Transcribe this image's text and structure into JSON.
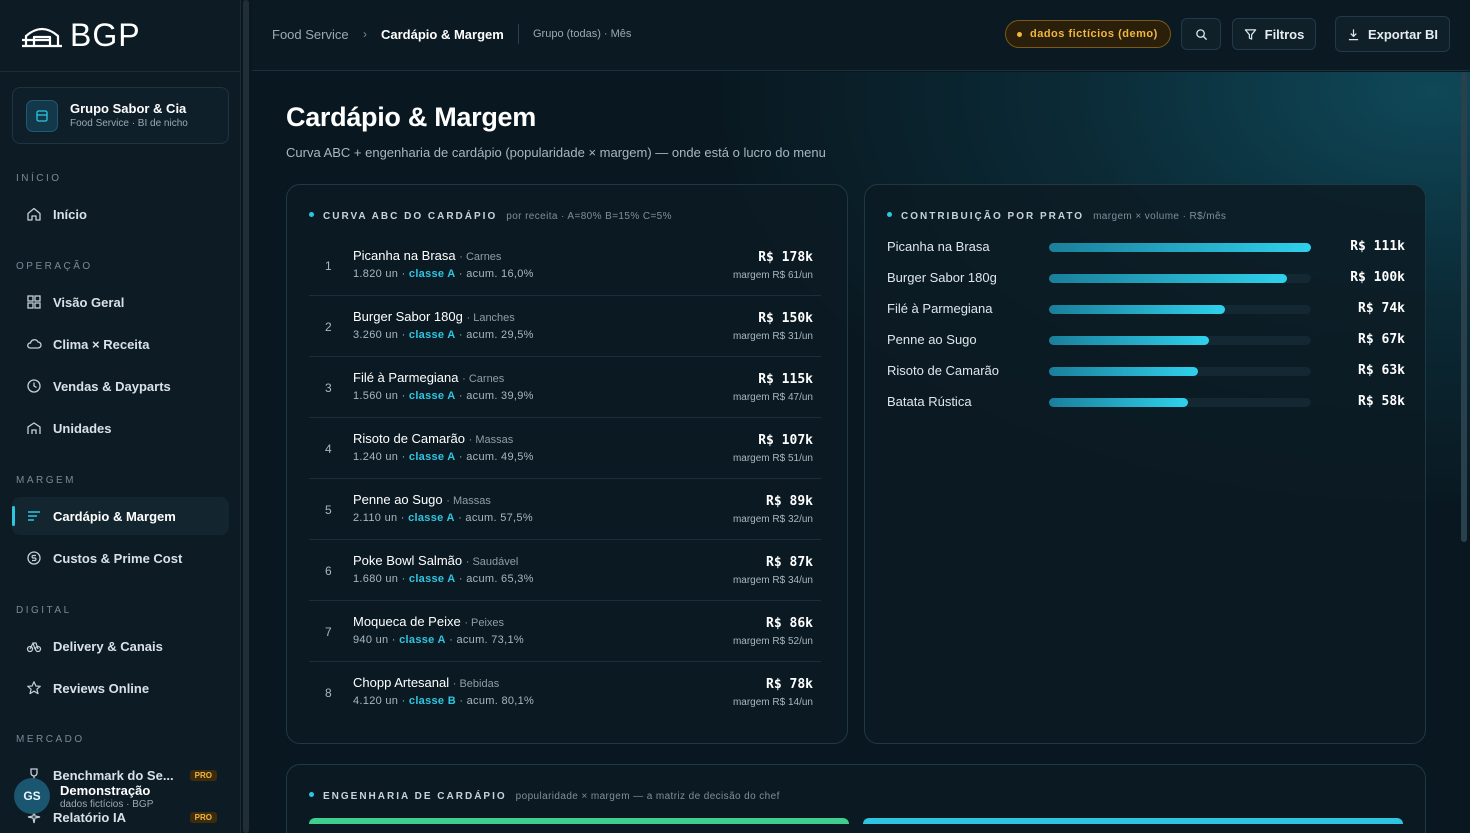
{
  "brand": {
    "logo_text": "BGP"
  },
  "org": {
    "name": "Grupo Sabor & Cia",
    "sub": "Food Service · BI de nicho"
  },
  "sidebar": {
    "sections": {
      "inicio": "INÍCIO",
      "operacao": "OPERAÇÃO",
      "margem": "MARGEM",
      "digital": "DIGITAL",
      "mercado": "MERCADO"
    },
    "items": {
      "inicio": "Início",
      "visao_geral": "Visão Geral",
      "clima": "Clima × Receita",
      "vendas": "Vendas & Dayparts",
      "unidades": "Unidades",
      "cardapio": "Cardápio & Margem",
      "custos": "Custos & Prime Cost",
      "delivery": "Delivery & Canais",
      "reviews": "Reviews Online",
      "benchmark": "Benchmark do Se...",
      "relatorio": "Relatório IA"
    },
    "pro_badge": "PRO"
  },
  "user": {
    "initials": "GS",
    "name": "Demonstração",
    "sub": "dados fictícios · BGP"
  },
  "topbar": {
    "crumb_parent": "Food Service",
    "crumb_sep": "›",
    "crumb_current": "Cardápio & Margem",
    "context": "Grupo (todas) · Mês",
    "demo_badge": "dados fictícios (demo)",
    "filters_label": "Filtros",
    "export_label": "Exportar BI"
  },
  "page": {
    "title": "Cardápio & Margem",
    "subtitle": "Curva ABC + engenharia de cardápio (popularidade × margem) — onde está o lucro do menu"
  },
  "abc": {
    "title": "CURVA ABC DO CARDÁPIO",
    "subtitle": "por receita · A=80% B=15% C=5%",
    "rows": [
      {
        "rank": "1",
        "name": "Picanha na Brasa",
        "cat": "· Carnes",
        "units": "1.820 un ·",
        "cls": "classe A",
        "acum": "· acum. 16,0%",
        "revenue": "R$ 178k",
        "margin": "margem R$ 61/un"
      },
      {
        "rank": "2",
        "name": "Burger Sabor 180g",
        "cat": "· Lanches",
        "units": "3.260 un ·",
        "cls": "classe A",
        "acum": "· acum. 29,5%",
        "revenue": "R$ 150k",
        "margin": "margem R$ 31/un"
      },
      {
        "rank": "3",
        "name": "Filé à Parmegiana",
        "cat": "· Carnes",
        "units": "1.560 un ·",
        "cls": "classe A",
        "acum": "· acum. 39,9%",
        "revenue": "R$ 115k",
        "margin": "margem R$ 47/un"
      },
      {
        "rank": "4",
        "name": "Risoto de Camarão",
        "cat": "· Massas",
        "units": "1.240 un ·",
        "cls": "classe A",
        "acum": "· acum. 49,5%",
        "revenue": "R$ 107k",
        "margin": "margem R$ 51/un"
      },
      {
        "rank": "5",
        "name": "Penne ao Sugo",
        "cat": "· Massas",
        "units": "2.110 un ·",
        "cls": "classe A",
        "acum": "· acum. 57,5%",
        "revenue": "R$ 89k",
        "margin": "margem R$ 32/un"
      },
      {
        "rank": "6",
        "name": "Poke Bowl Salmão",
        "cat": "· Saudável",
        "units": "1.680 un ·",
        "cls": "classe A",
        "acum": "· acum. 65,3%",
        "revenue": "R$ 87k",
        "margin": "margem R$ 34/un"
      },
      {
        "rank": "7",
        "name": "Moqueca de Peixe",
        "cat": "· Peixes",
        "units": "940 un ·",
        "cls": "classe A",
        "acum": "· acum. 73,1%",
        "revenue": "R$ 86k",
        "margin": "margem R$ 52/un"
      },
      {
        "rank": "8",
        "name": "Chopp Artesanal",
        "cat": "· Bebidas",
        "units": "4.120 un ·",
        "cls": "classe B",
        "acum": "· acum. 80,1%",
        "revenue": "R$ 78k",
        "margin": "margem R$ 14/un"
      }
    ]
  },
  "contrib": {
    "title": "CONTRIBUIÇÃO POR PRATO",
    "subtitle": "margem × volume · R$/mês",
    "rows": [
      {
        "name": "Picanha na Brasa",
        "value": "R$ 111k",
        "fraction": 1.0
      },
      {
        "name": "Burger Sabor 180g",
        "value": "R$ 100k",
        "fraction": 0.91
      },
      {
        "name": "Filé à Parmegiana",
        "value": "R$ 74k",
        "fraction": 0.67
      },
      {
        "name": "Penne ao Sugo",
        "value": "R$ 67k",
        "fraction": 0.61
      },
      {
        "name": "Risoto de Camarão",
        "value": "R$ 63k",
        "fraction": 0.57
      },
      {
        "name": "Batata Rústica",
        "value": "R$ 58k",
        "fraction": 0.53
      }
    ]
  },
  "engineering": {
    "title": "ENGENHARIA DE CARDÁPIO",
    "subtitle": "popularidade × margem — a matriz de decisão do chef"
  },
  "colors": {
    "accent": "#2ec5e0",
    "warning": "#f3b63f",
    "star": "#3ecf8e"
  }
}
